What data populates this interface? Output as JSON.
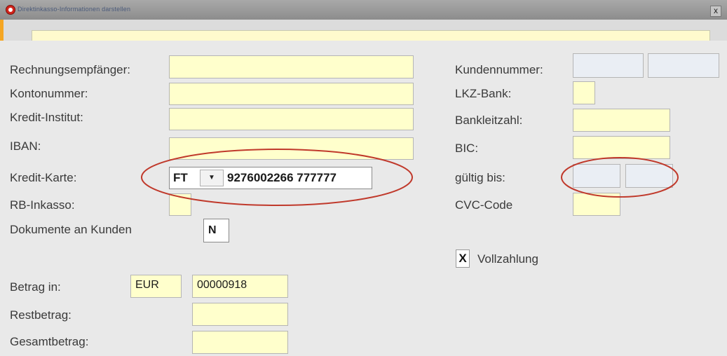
{
  "window": {
    "title": "Direktinkasso-Informationen darstellen",
    "close_label": "x"
  },
  "labels": {
    "rechnungsempfaenger": "Rechnungsempfänger:",
    "kontonummer": "Kontonummer:",
    "kredit_institut": "Kredit-Institut:",
    "iban": "IBAN:",
    "kredit_karte": "Kredit-Karte:",
    "rb_inkasso": "RB-Inkasso:",
    "dokumente_an_kunden": "Dokumente an Kunden",
    "betrag_in": "Betrag in:",
    "restbetrag": "Restbetrag:",
    "gesamtbetrag": "Gesamtbetrag:",
    "kundennummer": "Kundennummer:",
    "lkz_bank": "LKZ-Bank:",
    "bankleitzahl": "Bankleitzahl:",
    "bic": "BIC:",
    "gueltig_bis": "gültig bis:",
    "cvc_code": "CVC-Code",
    "vollzahlung": "Vollzahlung"
  },
  "values": {
    "kredit_karte_type": "FT",
    "kredit_karte_number": "9276002266 777777",
    "dokumente_an_kunden": "N",
    "vollzahlung_checked": "X",
    "currency": "EUR",
    "betrag": "00000918",
    "restbetrag": "",
    "gesamtbetrag": ""
  },
  "icons": {
    "app": "app-icon",
    "dropdown": "chevron-down-icon"
  },
  "colors": {
    "field_background": "#ffffcc",
    "readonly_field_background": "#eaeef4",
    "annotation_ovals": "#c0392b"
  }
}
